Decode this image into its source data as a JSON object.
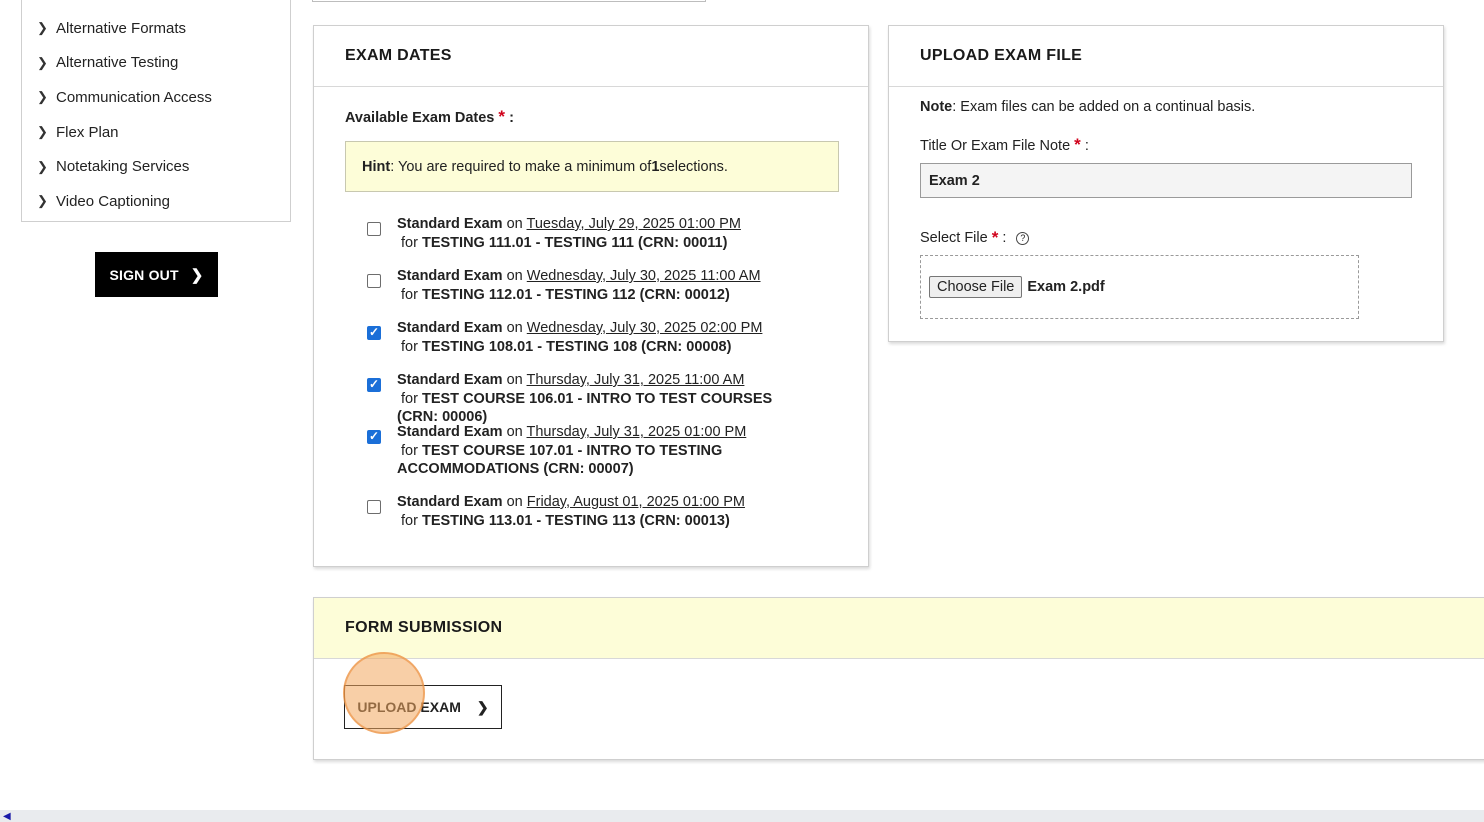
{
  "sidebar": {
    "items": [
      {
        "label": "Alternative Formats"
      },
      {
        "label": "Alternative Testing"
      },
      {
        "label": "Communication Access"
      },
      {
        "label": "Flex Plan"
      },
      {
        "label": "Notetaking Services"
      },
      {
        "label": "Video Captioning"
      }
    ],
    "sign_out_label": "SIGN OUT"
  },
  "exam_dates": {
    "title": "EXAM DATES",
    "available_label": "Available Exam Dates",
    "hint_prefix": "Hint",
    "hint_text": ": You are required to make a minimum of ",
    "hint_min": "1",
    "hint_suffix": " selections.",
    "exams": [
      {
        "type": "Standard Exam",
        "on": " on ",
        "date": "Tuesday, July 29, 2025 01:00 PM",
        "for_": " for ",
        "course": "TESTING 111.01 - TESTING 111 (CRN: 00011)",
        "checked": false
      },
      {
        "type": "Standard Exam",
        "on": " on ",
        "date": "Wednesday, July 30, 2025 11:00 AM",
        "for_": " for ",
        "course": "TESTING 112.01 - TESTING 112 (CRN: 00012)",
        "checked": false
      },
      {
        "type": "Standard Exam",
        "on": " on ",
        "date": "Wednesday, July 30, 2025 02:00 PM",
        "for_": " for ",
        "course": "TESTING 108.01 - TESTING 108 (CRN: 00008)",
        "checked": true
      },
      {
        "type": "Standard Exam",
        "on": " on ",
        "date": "Thursday, July 31, 2025 11:00 AM",
        "for_": " for ",
        "course": "TEST COURSE 106.01 - INTRO TO TEST COURSES (CRN: 00006)",
        "checked": true
      },
      {
        "type": "Standard Exam",
        "on": " on ",
        "date": "Thursday, July 31, 2025 01:00 PM",
        "for_": " for ",
        "course": "TEST COURSE 107.01 - INTRO TO TESTING ACCOMMODATIONS (CRN: 00007)",
        "checked": true
      },
      {
        "type": "Standard Exam",
        "on": " on ",
        "date": "Friday, August 01, 2025 01:00 PM",
        "for_": " for ",
        "course": "TESTING 113.01 - TESTING 113 (CRN: 00013)",
        "checked": false
      }
    ]
  },
  "upload": {
    "title": "UPLOAD EXAM FILE",
    "note_prefix": "Note",
    "note_text": ": Exam files can be added on a continual basis.",
    "title_label": "Title Or Exam File Note",
    "title_value": "Exam 2",
    "select_label": "Select File",
    "help_icon": "?",
    "choose_label": "Choose File",
    "file_name": "Exam 2.pdf"
  },
  "form_submission": {
    "title": "FORM SUBMISSION",
    "upload_button_label": "UPLOAD EXAM"
  },
  "common": {
    "required_mark": "*",
    "colon": ":"
  },
  "colors": {
    "accent_checkbox": "#1b6fd8",
    "hint_bg": "#fdfdd8",
    "required": "#d0021b",
    "click_highlight": "#f3a85f"
  }
}
